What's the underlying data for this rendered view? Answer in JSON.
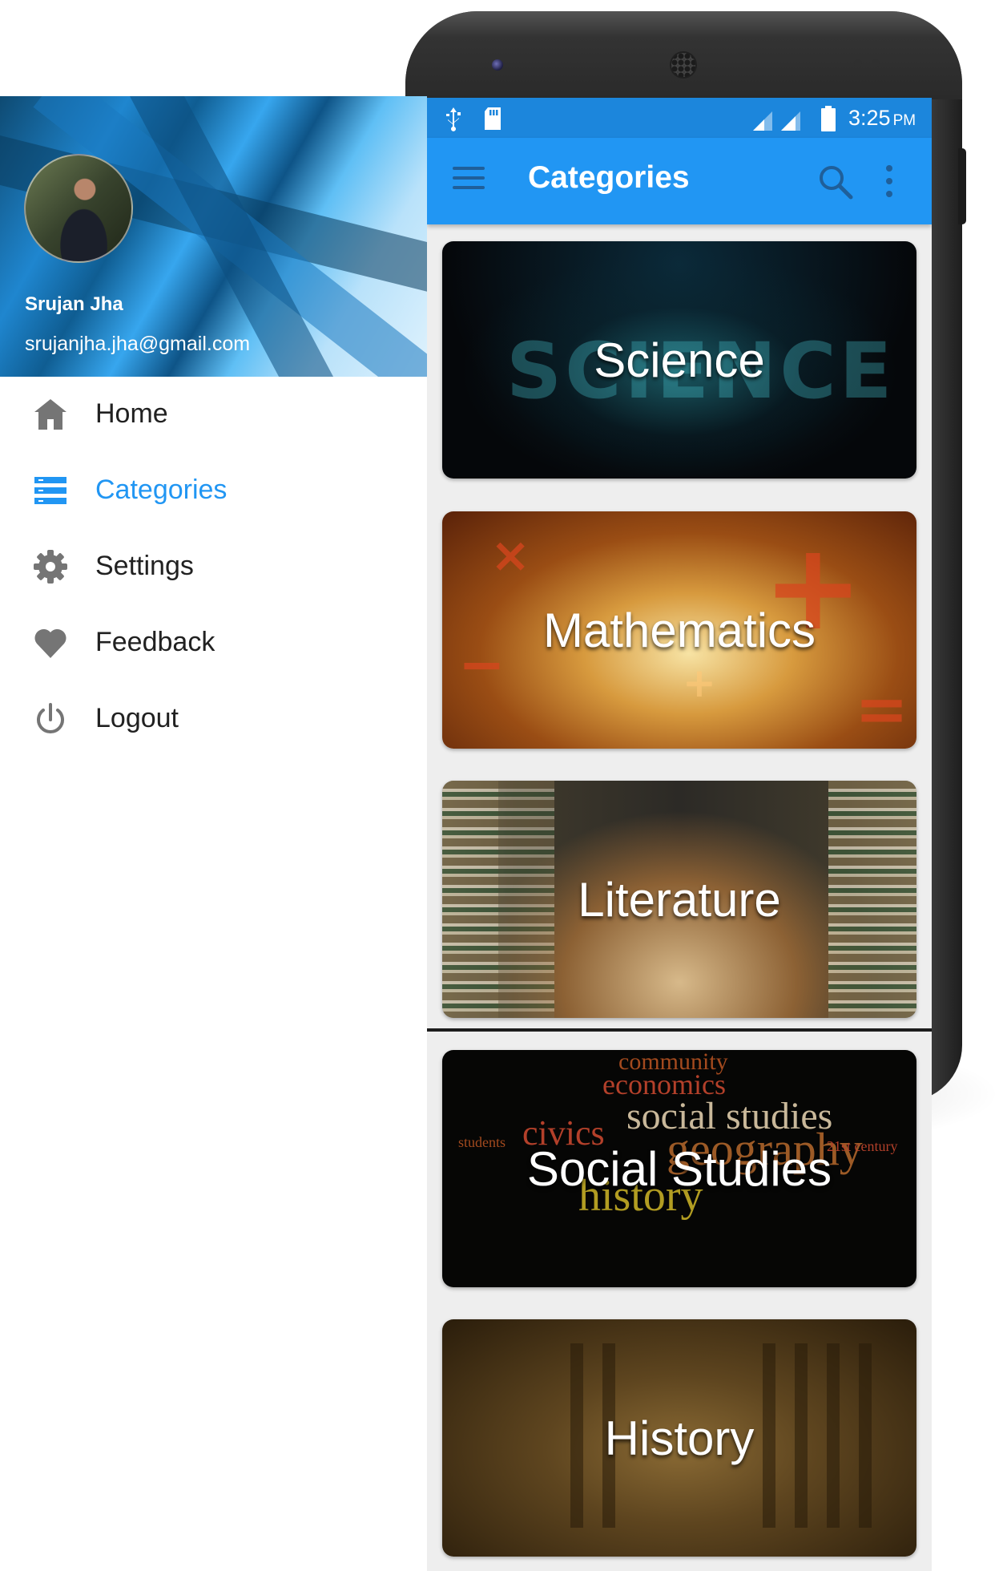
{
  "status_bar": {
    "time": "3:25",
    "ampm": "PM"
  },
  "app_bar": {
    "title": "Categories",
    "menu_icon": "hamburger-menu-icon",
    "search_icon": "search-icon",
    "overflow_icon": "more-vert-icon"
  },
  "categories": [
    {
      "label": "Science"
    },
    {
      "label": "Mathematics"
    },
    {
      "label": "Literature"
    },
    {
      "label": "Social Studies"
    },
    {
      "label": "History"
    }
  ],
  "drawer": {
    "user_name": "Srujan Jha",
    "user_email": "srujanjha.jha@gmail.com",
    "items": [
      {
        "label": "Home",
        "icon": "home-icon"
      },
      {
        "label": "Categories",
        "icon": "list-icon",
        "active": true
      },
      {
        "label": "Settings",
        "icon": "gear-icon"
      },
      {
        "label": "Feedback",
        "icon": "heart-icon"
      },
      {
        "label": "Logout",
        "icon": "power-icon"
      }
    ]
  },
  "colors": {
    "primary": "#2196f3",
    "status_bar": "#1c86dc",
    "active_text": "#2196f3"
  }
}
